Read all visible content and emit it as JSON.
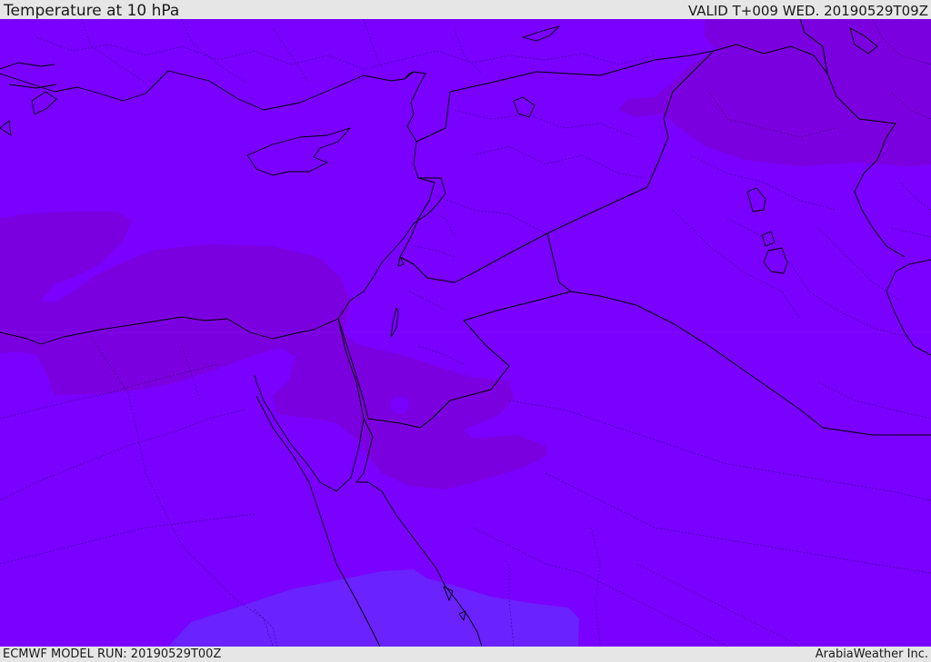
{
  "header": {
    "title": "Temperature at 10 hPa",
    "valid": "VALID T+009 WED. 20190529T09Z"
  },
  "footer": {
    "run": "ECMWF MODEL RUN: 20190529T00Z",
    "brand": "ArabiaWeather Inc."
  },
  "map": {
    "colors": {
      "base_field": "#7a00ff",
      "warm_zone": "#7b00df",
      "cool_zone": "#6a22ff"
    }
  }
}
